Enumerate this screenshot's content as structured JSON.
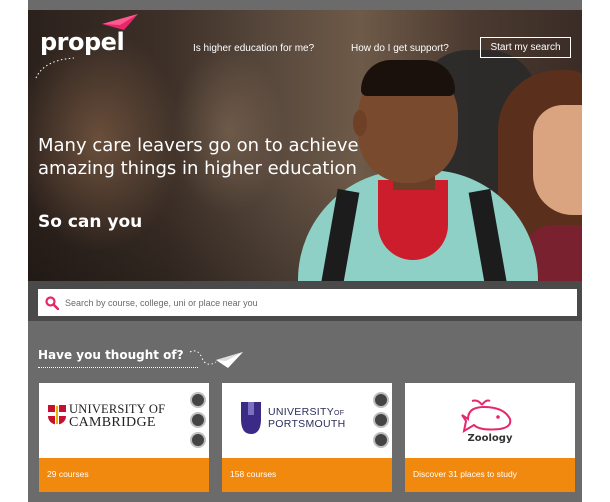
{
  "brand": {
    "logo": "propel",
    "accent": "#e6276b",
    "orange": "#f2890f"
  },
  "nav": {
    "link_1": "Is higher education for me?",
    "link_2": "How do I get support?",
    "cta": "Start my search"
  },
  "hero": {
    "headline": "Many care leavers go on to achieve amazing things in higher education",
    "subhead": "So can you"
  },
  "search": {
    "placeholder": "Search by course, college, uni or place near you",
    "value": ""
  },
  "thought": {
    "title": "Have you thought of?",
    "cards": [
      {
        "logo_line_1": "UNIVERSITY OF",
        "logo_line_2": "CAMBRIDGE",
        "footer": "29 courses"
      },
      {
        "logo_line_1": "UNIVERSITY",
        "logo_of": "OF",
        "logo_line_2": "PORTSMOUTH",
        "footer": "158 courses"
      },
      {
        "label": "Zoology",
        "footer": "Discover 31 places to study"
      }
    ]
  }
}
